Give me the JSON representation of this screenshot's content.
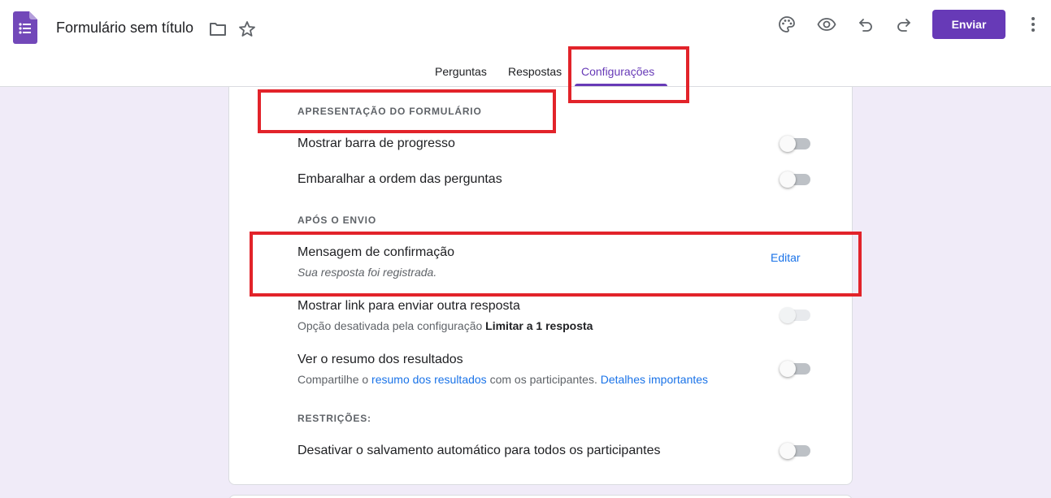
{
  "header": {
    "title": "Formulário sem título",
    "send_label": "Enviar",
    "icons": [
      "forms-logo-icon",
      "folder-icon",
      "star-icon",
      "palette-icon",
      "eye-icon",
      "undo-icon",
      "redo-icon",
      "more-vert-icon"
    ]
  },
  "tabs": [
    {
      "label": "Perguntas",
      "active": false
    },
    {
      "label": "Respostas",
      "active": false
    },
    {
      "label": "Configurações",
      "active": true
    }
  ],
  "settings": {
    "presentation": {
      "heading": "APRESENTAÇÃO DO FORMULÁRIO",
      "progress_bar": {
        "title": "Mostrar barra de progresso",
        "enabled": false
      },
      "shuffle": {
        "title": "Embaralhar a ordem das perguntas",
        "enabled": false
      }
    },
    "after_submit": {
      "heading": "APÓS O ENVIO",
      "confirmation": {
        "title": "Mensagem de confirmação",
        "message": "Sua resposta foi registrada.",
        "edit_label": "Editar"
      },
      "another_response": {
        "title": "Mostrar link para enviar outra resposta",
        "sub_prefix": "Opção desativada pela configuração ",
        "sub_bold": "Limitar a 1 resposta",
        "enabled": false,
        "disabled": true
      },
      "results_summary": {
        "title": "Ver o resumo dos resultados",
        "sub_part1": "Compartilhe o ",
        "sub_link1": "resumo dos resultados",
        "sub_part2": " com os participantes. ",
        "sub_link2": "Detalhes importantes",
        "enabled": false
      }
    },
    "restrictions": {
      "heading": "RESTRIÇÕES:",
      "autosave": {
        "title": "Desativar o salvamento automático para todos os participantes",
        "enabled": false
      }
    }
  },
  "colors": {
    "accent": "#673ab7",
    "background": "#f0ebf8",
    "link": "#1a73e8",
    "highlight": "#e2232a"
  }
}
